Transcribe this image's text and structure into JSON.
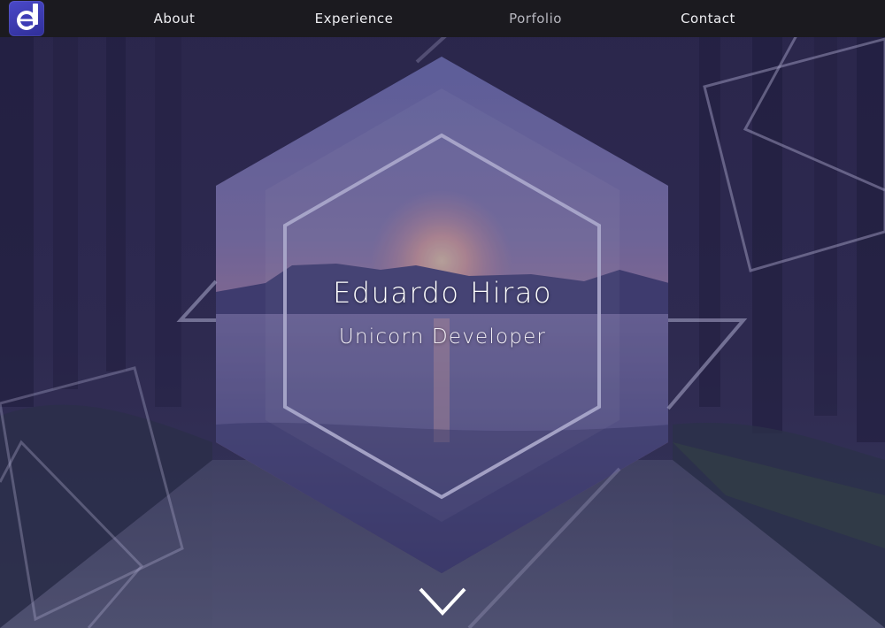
{
  "nav": {
    "logo_letter": "d",
    "links": [
      {
        "label": "About"
      },
      {
        "label": "Experience"
      },
      {
        "label": "Porfolio"
      },
      {
        "label": "Contact"
      }
    ],
    "active_index": 2
  },
  "hero": {
    "name": "Eduardo Hirao",
    "role": "Unicorn Developer"
  },
  "icons": {
    "logo": "d-logo-icon",
    "scroll": "chevron-down-icon"
  },
  "colors": {
    "overlay": "#2f2a5c",
    "nav_bg": "#1b1a1f",
    "accent": "#3f3db8",
    "line": "#c9c6e6"
  }
}
